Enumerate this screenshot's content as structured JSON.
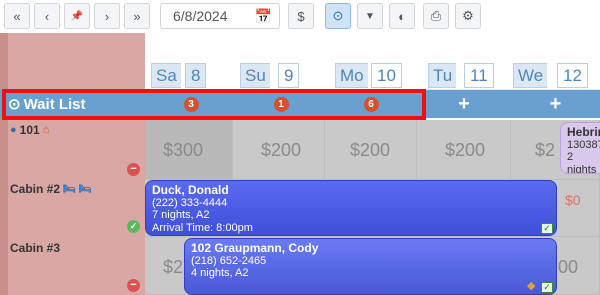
{
  "toolbar": {
    "first_icon": "«",
    "prev_icon": "‹",
    "pin_icon": "📌",
    "next_icon": "›",
    "last_icon": "»",
    "date_value": "6/8/2024",
    "calendar_icon": "📅",
    "dollar_icon": "$",
    "clock_icon": "⊙",
    "filter_icon": "▼",
    "contrast_icon": "◐",
    "print_icon": "⎙",
    "gear_icon": "⚙"
  },
  "days": [
    {
      "abbr": "Sa",
      "num": "8"
    },
    {
      "abbr": "Su",
      "num": "9"
    },
    {
      "abbr": "Mo",
      "num": "10"
    },
    {
      "abbr": "Tu",
      "num": "11"
    },
    {
      "abbr": "We",
      "num": "12"
    }
  ],
  "wait_list": {
    "label": "Wait List",
    "icon": "⊙",
    "counts": [
      "3",
      "1",
      "6"
    ],
    "add": "+"
  },
  "rooms": [
    {
      "name": "101",
      "prices": [
        "$300",
        "$200",
        "$200",
        "$200",
        "$2"
      ]
    },
    {
      "name": "Cabin #2",
      "prices": [
        "",
        "",
        "",
        "",
        "$0"
      ]
    },
    {
      "name": "Cabin #3",
      "prices": [
        "$2",
        "",
        "",
        "",
        "00"
      ]
    }
  ],
  "bookings": {
    "hebrin": {
      "name": "Hebrin",
      "phone": "130387",
      "nights": "2 nights"
    },
    "duck": {
      "name": "Duck, Donald",
      "phone": "(222) 333-4444",
      "detail": "7 nights, A2",
      "arrival": "Arrival Time: 8:00pm"
    },
    "graupmann": {
      "name": "102 Graupmann, Cody",
      "phone": "(218) 652-2465",
      "detail": "4 nights, A2"
    }
  },
  "colors": {
    "accent": "#6aa0cf",
    "highlight": "#ee1111",
    "badge": "#d4502f",
    "booking_blue": "#4a5ae0",
    "left_column": "#d9a8a4"
  }
}
